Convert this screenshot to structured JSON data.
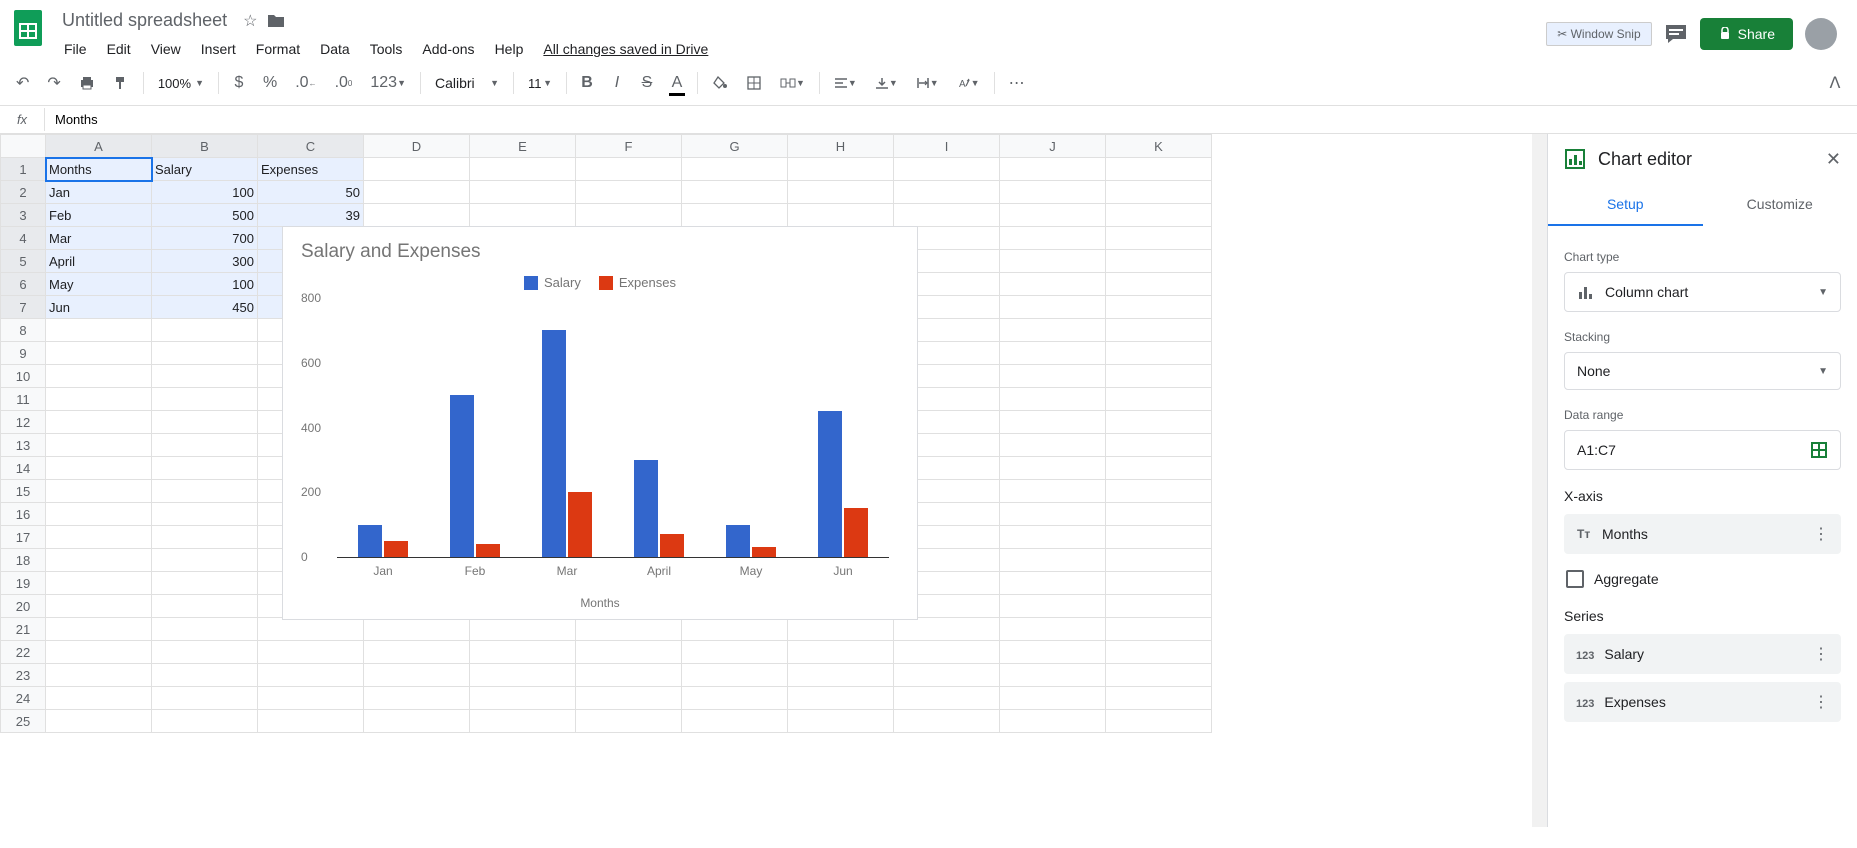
{
  "app": {
    "title": "Untitled spreadsheet",
    "snipLabel": "Window Snip",
    "shareLabel": "Share",
    "saveStatus": "All changes saved in Drive"
  },
  "menubar": [
    "File",
    "Edit",
    "View",
    "Insert",
    "Format",
    "Data",
    "Tools",
    "Add-ons",
    "Help"
  ],
  "toolbar": {
    "zoom": "100%",
    "formats": [
      "$",
      "%",
      ".0",
      ".00"
    ],
    "numFormat": "123",
    "font": "Calibri",
    "fontSize": "11"
  },
  "formulaBar": {
    "fx": "fx",
    "value": "Months"
  },
  "columns": [
    "A",
    "B",
    "C",
    "D",
    "E",
    "F",
    "G",
    "H",
    "I",
    "J",
    "K"
  ],
  "rowCount": 25,
  "sheet": {
    "headers": [
      "Months",
      "Salary",
      "Expenses"
    ],
    "rows": [
      {
        "m": "Jan",
        "s": "100",
        "e": "50"
      },
      {
        "m": "Feb",
        "s": "500",
        "e": "39"
      },
      {
        "m": "Mar",
        "s": "700",
        "e": ""
      },
      {
        "m": "April",
        "s": "300",
        "e": ""
      },
      {
        "m": "May",
        "s": "100",
        "e": ""
      },
      {
        "m": "Jun",
        "s": "450",
        "e": ""
      }
    ]
  },
  "chart_data": {
    "type": "bar",
    "title": "Salary and Expenses",
    "categories": [
      "Jan",
      "Feb",
      "Mar",
      "April",
      "May",
      "Jun"
    ],
    "series": [
      {
        "name": "Salary",
        "color": "#3366cc",
        "values": [
          100,
          500,
          700,
          300,
          100,
          450
        ]
      },
      {
        "name": "Expenses",
        "color": "#dc3912",
        "values": [
          50,
          39,
          200,
          70,
          30,
          150
        ]
      }
    ],
    "ylim": [
      0,
      800
    ],
    "yticks": [
      0,
      200,
      400,
      600,
      800
    ],
    "xlabel": "Months",
    "ylabel": ""
  },
  "editor": {
    "title": "Chart editor",
    "tabs": {
      "setup": "Setup",
      "customize": "Customize"
    },
    "chartTypeLabel": "Chart type",
    "chartType": "Column chart",
    "stackingLabel": "Stacking",
    "stacking": "None",
    "dataRangeLabel": "Data range",
    "dataRange": "A1:C7",
    "xaxisTitle": "X-axis",
    "xaxis": "Months",
    "aggregate": "Aggregate",
    "seriesTitle": "Series",
    "series1": "Salary",
    "series2": "Expenses"
  }
}
